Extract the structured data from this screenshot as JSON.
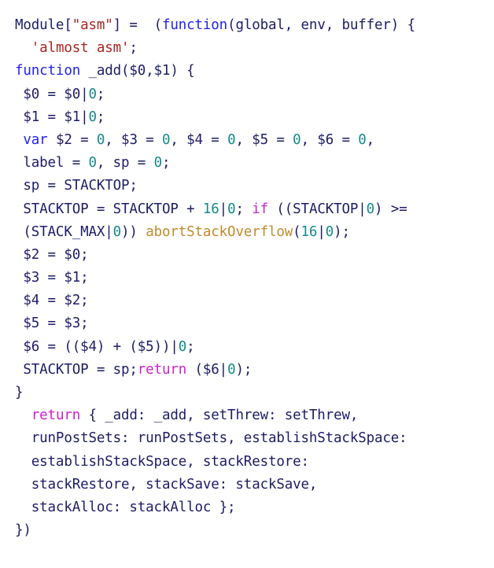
{
  "editor": {
    "language": "javascript",
    "background_color": "#ffffff",
    "font_size_px": 17.5,
    "line_height_px": 29.2,
    "line_count": 22
  },
  "theme": {
    "identifier_color": "#1c1c66",
    "keyword_color": "#2222ee",
    "control_keyword_color": "#cc22cc",
    "number_color": "#15898a",
    "string_color": "#ab2420",
    "function_call_color": "#c08a2c",
    "punctuation_color": "#1c1c66"
  },
  "lines": [
    {
      "n": 1,
      "indent": 0,
      "text": "Module[\"asm\"] =  (function(global, env, buffer) {",
      "tokens": [
        {
          "t": "Module",
          "c": "plain"
        },
        {
          "t": "[",
          "c": "punct"
        },
        {
          "t": "\"asm\"",
          "c": "str"
        },
        {
          "t": "]",
          "c": "punct"
        },
        {
          "t": " =  (",
          "c": "punct"
        },
        {
          "t": "function",
          "c": "kw"
        },
        {
          "t": "(global, env, buffer) {",
          "c": "plain"
        }
      ]
    },
    {
      "n": 2,
      "indent": 2,
      "text": "  'almost asm';",
      "tokens": [
        {
          "t": "  ",
          "c": "plain"
        },
        {
          "t": "'almost asm'",
          "c": "str"
        },
        {
          "t": ";",
          "c": "punct"
        }
      ]
    },
    {
      "n": 3,
      "indent": 0,
      "text": "function _add($0,$1) {",
      "tokens": [
        {
          "t": "function",
          "c": "kw"
        },
        {
          "t": " _add($0,$1) {",
          "c": "plain"
        }
      ]
    },
    {
      "n": 4,
      "indent": 1,
      "text": " $0 = $0|0;",
      "tokens": [
        {
          "t": " $0 = $0|",
          "c": "plain"
        },
        {
          "t": "0",
          "c": "num"
        },
        {
          "t": ";",
          "c": "punct"
        }
      ]
    },
    {
      "n": 5,
      "indent": 1,
      "text": " $1 = $1|0;",
      "tokens": [
        {
          "t": " $1 = $1|",
          "c": "plain"
        },
        {
          "t": "0",
          "c": "num"
        },
        {
          "t": ";",
          "c": "punct"
        }
      ]
    },
    {
      "n": 6,
      "indent": 1,
      "text": " var $2 = 0, $3 = 0, $4 = 0, $5 = 0, $6 = 0,",
      "tokens": [
        {
          "t": " ",
          "c": "plain"
        },
        {
          "t": "var",
          "c": "kw"
        },
        {
          "t": " $2 = ",
          "c": "plain"
        },
        {
          "t": "0",
          "c": "num"
        },
        {
          "t": ", $3 = ",
          "c": "plain"
        },
        {
          "t": "0",
          "c": "num"
        },
        {
          "t": ", $4 = ",
          "c": "plain"
        },
        {
          "t": "0",
          "c": "num"
        },
        {
          "t": ", $5 = ",
          "c": "plain"
        },
        {
          "t": "0",
          "c": "num"
        },
        {
          "t": ", $6 = ",
          "c": "plain"
        },
        {
          "t": "0",
          "c": "num"
        },
        {
          "t": ",",
          "c": "punct"
        }
      ]
    },
    {
      "n": 7,
      "indent": 1,
      "text": " label = 0, sp = 0;",
      "tokens": [
        {
          "t": " label = ",
          "c": "plain"
        },
        {
          "t": "0",
          "c": "num"
        },
        {
          "t": ", sp = ",
          "c": "plain"
        },
        {
          "t": "0",
          "c": "num"
        },
        {
          "t": ";",
          "c": "punct"
        }
      ]
    },
    {
      "n": 8,
      "indent": 1,
      "text": " sp = STACKTOP;",
      "tokens": [
        {
          "t": " sp = STACKTOP;",
          "c": "plain"
        }
      ]
    },
    {
      "n": 9,
      "indent": 1,
      "text": " STACKTOP = STACKTOP + 16|0; if ((STACKTOP|0) >=",
      "tokens": [
        {
          "t": " STACKTOP = STACKTOP + ",
          "c": "plain"
        },
        {
          "t": "16",
          "c": "num"
        },
        {
          "t": "|",
          "c": "plain"
        },
        {
          "t": "0",
          "c": "num"
        },
        {
          "t": "; ",
          "c": "punct"
        },
        {
          "t": "if",
          "c": "ctrl"
        },
        {
          "t": " ((STACKTOP|",
          "c": "plain"
        },
        {
          "t": "0",
          "c": "num"
        },
        {
          "t": ") >=",
          "c": "plain"
        }
      ]
    },
    {
      "n": 10,
      "indent": 1,
      "text": " (STACK_MAX|0)) abortStackOverflow(16|0);",
      "tokens": [
        {
          "t": " (STACK_MAX|",
          "c": "plain"
        },
        {
          "t": "0",
          "c": "num"
        },
        {
          "t": ")) ",
          "c": "plain"
        },
        {
          "t": "abortStackOverflow",
          "c": "fn"
        },
        {
          "t": "(",
          "c": "plain"
        },
        {
          "t": "16",
          "c": "num"
        },
        {
          "t": "|",
          "c": "plain"
        },
        {
          "t": "0",
          "c": "num"
        },
        {
          "t": ");",
          "c": "plain"
        }
      ]
    },
    {
      "n": 11,
      "indent": 1,
      "text": " $2 = $0;",
      "tokens": [
        {
          "t": " $2 = $0;",
          "c": "plain"
        }
      ]
    },
    {
      "n": 12,
      "indent": 1,
      "text": " $3 = $1;",
      "tokens": [
        {
          "t": " $3 = $1;",
          "c": "plain"
        }
      ]
    },
    {
      "n": 13,
      "indent": 1,
      "text": " $4 = $2;",
      "tokens": [
        {
          "t": " $4 = $2;",
          "c": "plain"
        }
      ]
    },
    {
      "n": 14,
      "indent": 1,
      "text": " $5 = $3;",
      "tokens": [
        {
          "t": " $5 = $3;",
          "c": "plain"
        }
      ]
    },
    {
      "n": 15,
      "indent": 1,
      "text": " $6 = (($4) + ($5))|0;",
      "tokens": [
        {
          "t": " $6 = (($4) + ($5))|",
          "c": "plain"
        },
        {
          "t": "0",
          "c": "num"
        },
        {
          "t": ";",
          "c": "punct"
        }
      ]
    },
    {
      "n": 16,
      "indent": 1,
      "text": " STACKTOP = sp;return ($6|0);",
      "tokens": [
        {
          "t": " STACKTOP = sp;",
          "c": "plain"
        },
        {
          "t": "return",
          "c": "ctrl"
        },
        {
          "t": " ($6|",
          "c": "plain"
        },
        {
          "t": "0",
          "c": "num"
        },
        {
          "t": ");",
          "c": "plain"
        }
      ]
    },
    {
      "n": 17,
      "indent": 0,
      "text": "}",
      "tokens": [
        {
          "t": "}",
          "c": "plain"
        }
      ]
    },
    {
      "n": 18,
      "indent": 2,
      "text": "  return { _add: _add, setThrew: setThrew,",
      "tokens": [
        {
          "t": "  ",
          "c": "plain"
        },
        {
          "t": "return",
          "c": "ctrl"
        },
        {
          "t": " { _add: _add, setThrew: setThrew,",
          "c": "plain"
        }
      ]
    },
    {
      "n": 19,
      "indent": 2,
      "text": "  runPostSets: runPostSets, establishStackSpace:",
      "tokens": [
        {
          "t": "  runPostSets: runPostSets, establishStackSpace:",
          "c": "plain"
        }
      ]
    },
    {
      "n": 20,
      "indent": 2,
      "text": "  establishStackSpace, stackRestore:",
      "tokens": [
        {
          "t": "  establishStackSpace, stackRestore:",
          "c": "plain"
        }
      ]
    },
    {
      "n": 21,
      "indent": 2,
      "text": "  stackRestore, stackSave: stackSave,",
      "tokens": [
        {
          "t": "  stackRestore, stackSave: stackSave,",
          "c": "plain"
        }
      ]
    },
    {
      "n": 22,
      "indent": 2,
      "text": "  stackAlloc: stackAlloc };",
      "tokens": [
        {
          "t": "  stackAlloc: stackAlloc };",
          "c": "plain"
        }
      ]
    },
    {
      "n": 23,
      "indent": 0,
      "text": "})",
      "tokens": [
        {
          "t": "})",
          "c": "plain"
        }
      ]
    }
  ]
}
